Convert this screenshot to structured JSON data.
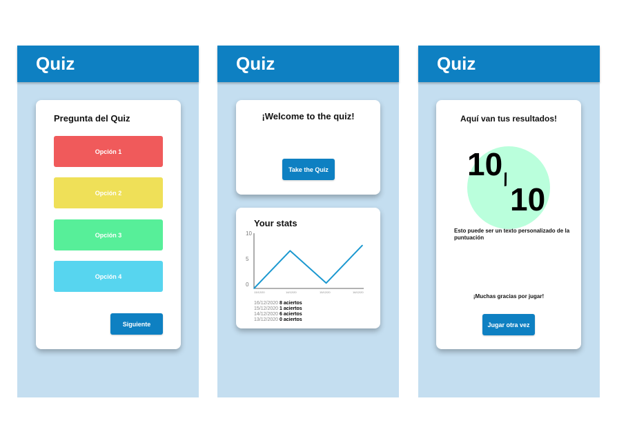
{
  "colors": {
    "header": "#0e80c2",
    "background": "#c4def0",
    "option1": "#f05a5b",
    "option2": "#efe058",
    "option3": "#57ef99",
    "option4": "#57d5ef",
    "button": "#0e80c2",
    "score_circle": "#baffdc",
    "line": "#1b98d0"
  },
  "screen1": {
    "header_title": "Quiz",
    "question_title": "Pregunta del Quiz",
    "options": [
      "Opción 1",
      "Opción 2",
      "Opción 3",
      "Opción 4"
    ],
    "next_button": "Siguiente"
  },
  "screen2": {
    "header_title": "Quiz",
    "welcome_title": "¡Welcome to the quiz!",
    "take_quiz_button": "Take the Quiz",
    "stats_title": "Your stats",
    "y_ticks": [
      "10",
      "5",
      "0"
    ],
    "x_ticks": [
      "13/12/20",
      "14/12/20",
      "15/12/20",
      "16/12/20"
    ],
    "stats": [
      {
        "date": "16/12/2020",
        "result": "8 aciertos"
      },
      {
        "date": "15/12/2020",
        "result": "1 aciertos"
      },
      {
        "date": "14/12/2020",
        "result": "6 aciertos"
      },
      {
        "date": "13/12/2020",
        "result": "0 aciertos"
      }
    ]
  },
  "chart_data": {
    "type": "line",
    "x": [
      "13/12/20",
      "14/12/20",
      "15/12/20",
      "16/12/20"
    ],
    "values": [
      0,
      7,
      1,
      8
    ],
    "title": "Your stats",
    "ylim": [
      0,
      10
    ],
    "grid": false
  },
  "screen3": {
    "header_title": "Quiz",
    "results_title": "Aquí van tus resultados!",
    "score": "10",
    "score_total": "10",
    "score_separator": "/",
    "custom_text": "Esto puede ser un texto personalizado de la puntuación",
    "thanks": "¡Muchas gracias por jugar!",
    "play_again_button": "Jugar otra vez"
  }
}
